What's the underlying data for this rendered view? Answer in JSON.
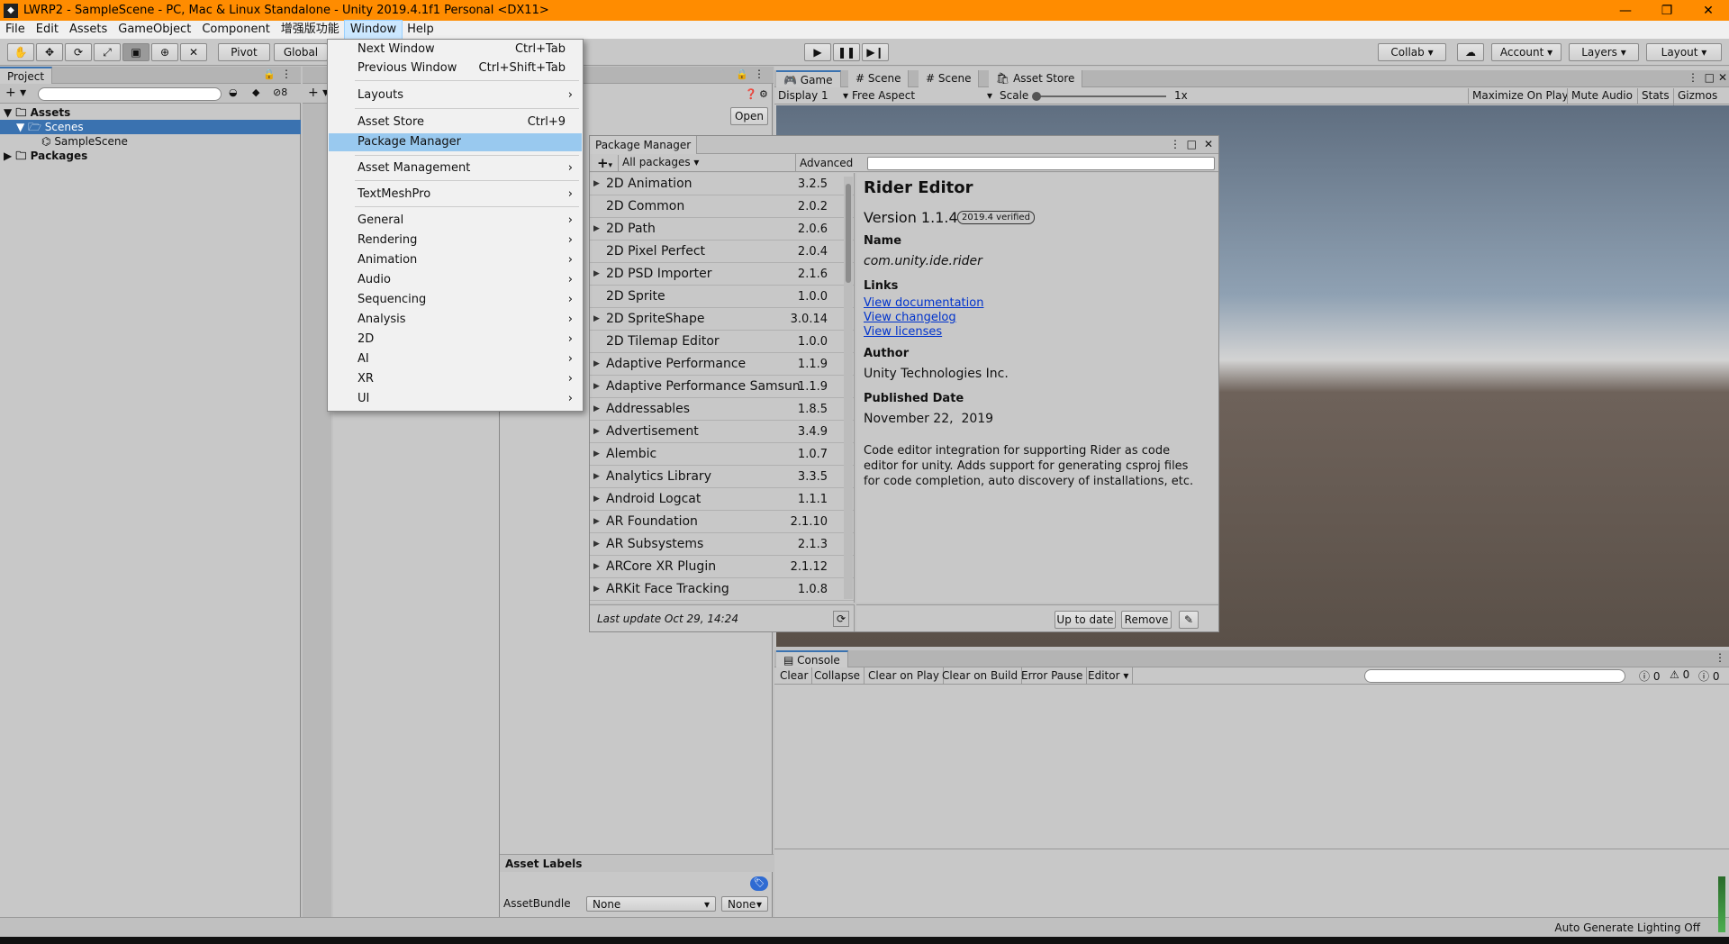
{
  "window": {
    "title": "LWRP2 - SampleScene - PC, Mac & Linux Standalone - Unity 2019.4.1f1 Personal <DX11>",
    "minimize": "—",
    "restore": "❐",
    "close": "✕"
  },
  "menubar": [
    "File",
    "Edit",
    "Assets",
    "GameObject",
    "Component",
    "增强版功能",
    "Window",
    "Help"
  ],
  "toolbar": {
    "pivot": "Pivot",
    "global": "Global",
    "collab": "Collab",
    "account": "Account",
    "layers": "Layers",
    "layout": "Layout"
  },
  "project": {
    "tab": "Project",
    "count": "8",
    "assets": "Assets",
    "scenes": "Scenes",
    "samplescene": "SampleScene",
    "packages": "Packages"
  },
  "inspector": {
    "open": "Open",
    "asset_labels": "Asset Labels",
    "assetbundle": "AssetBundle",
    "bundle_value": "None",
    "variant_value": "None"
  },
  "game_tabs": {
    "game": "Game",
    "scene1": "Scene",
    "scene2": "Scene",
    "asset_store": "Asset Store"
  },
  "game_bar": {
    "display": "Display 1",
    "aspect": "Free Aspect",
    "scale": "Scale",
    "scale_value": "1x",
    "maximize": "Maximize On Play",
    "mute": "Mute Audio",
    "stats": "Stats",
    "gizmos": "Gizmos"
  },
  "window_menu": [
    {
      "label": "Next Window",
      "shortcut": "Ctrl+Tab"
    },
    {
      "label": "Previous Window",
      "shortcut": "Ctrl+Shift+Tab"
    },
    {
      "label": "Layouts",
      "arrow": "›"
    },
    {
      "label": "Asset Store",
      "shortcut": "Ctrl+9"
    },
    {
      "label": "Package Manager"
    },
    {
      "label": "Asset Management",
      "arrow": "›"
    },
    {
      "label": "TextMeshPro",
      "arrow": "›"
    },
    {
      "label": "General",
      "arrow": "›"
    },
    {
      "label": "Rendering",
      "arrow": "›"
    },
    {
      "label": "Animation",
      "arrow": "›"
    },
    {
      "label": "Audio",
      "arrow": "›"
    },
    {
      "label": "Sequencing",
      "arrow": "›"
    },
    {
      "label": "Analysis",
      "arrow": "›"
    },
    {
      "label": "2D",
      "arrow": "›"
    },
    {
      "label": "AI",
      "arrow": "›"
    },
    {
      "label": "XR",
      "arrow": "›"
    },
    {
      "label": "UI",
      "arrow": "›"
    }
  ],
  "package_manager": {
    "title": "Package Manager",
    "add": "+",
    "filter": "All packages",
    "advanced": "Advanced",
    "packages": [
      {
        "name": "2D Animation",
        "version": "3.2.5",
        "expand": true
      },
      {
        "name": "2D Common",
        "version": "2.0.2",
        "expand": false
      },
      {
        "name": "2D Path",
        "version": "2.0.6",
        "expand": true
      },
      {
        "name": "2D Pixel Perfect",
        "version": "2.0.4",
        "expand": false
      },
      {
        "name": "2D PSD Importer",
        "version": "2.1.6",
        "expand": true
      },
      {
        "name": "2D Sprite",
        "version": "1.0.0",
        "expand": false
      },
      {
        "name": "2D SpriteShape",
        "version": "3.0.14",
        "expand": true
      },
      {
        "name": "2D Tilemap Editor",
        "version": "1.0.0",
        "expand": false
      },
      {
        "name": "Adaptive Performance",
        "version": "1.1.9",
        "expand": true
      },
      {
        "name": "Adaptive Performance Samsun",
        "version": "1.1.9",
        "expand": true
      },
      {
        "name": "Addressables",
        "version": "1.8.5",
        "expand": true
      },
      {
        "name": "Advertisement",
        "version": "3.4.9",
        "expand": true
      },
      {
        "name": "Alembic",
        "version": "1.0.7",
        "expand": true
      },
      {
        "name": "Analytics Library",
        "version": "3.3.5",
        "expand": true
      },
      {
        "name": "Android Logcat",
        "version": "1.1.1",
        "expand": true
      },
      {
        "name": "AR Foundation",
        "version": "2.1.10",
        "expand": true
      },
      {
        "name": "AR Subsystems",
        "version": "2.1.3",
        "expand": true
      },
      {
        "name": "ARCore XR Plugin",
        "version": "2.1.12",
        "expand": true
      },
      {
        "name": "ARKit Face Tracking",
        "version": "1.0.8",
        "expand": true
      }
    ],
    "last_update": "Last update Oct 29, 14:24",
    "detail": {
      "name": "Rider Editor",
      "version": "Version 1.1.4",
      "badge": "2019.4 verified",
      "name_label": "Name",
      "id": "com.unity.ide.rider",
      "links_label": "Links",
      "links": [
        "View documentation",
        "View changelog",
        "View licenses"
      ],
      "author_label": "Author",
      "author": "Unity Technologies Inc.",
      "published_label": "Published Date",
      "published": "November 22,  2019",
      "description": "Code editor integration for supporting Rider as code editor for unity. Adds support for generating csproj files for code completion, auto discovery of installations, etc."
    },
    "btn_uptodate": "Up to date",
    "btn_remove": "Remove"
  },
  "console": {
    "tab": "Console",
    "clear": "Clear",
    "collapse": "Collapse",
    "clear_on_play": "Clear on Play",
    "clear_on_build": "Clear on Build",
    "error_pause": "Error Pause",
    "editor": "Editor",
    "c1": "0",
    "c2": "0",
    "c3": "0"
  },
  "status": {
    "text": "Auto Generate Lighting Off"
  },
  "colors": {
    "titlebar": "#ff8c00",
    "selection": "#3a72b0",
    "menu_highlight": "#99c9ef"
  }
}
